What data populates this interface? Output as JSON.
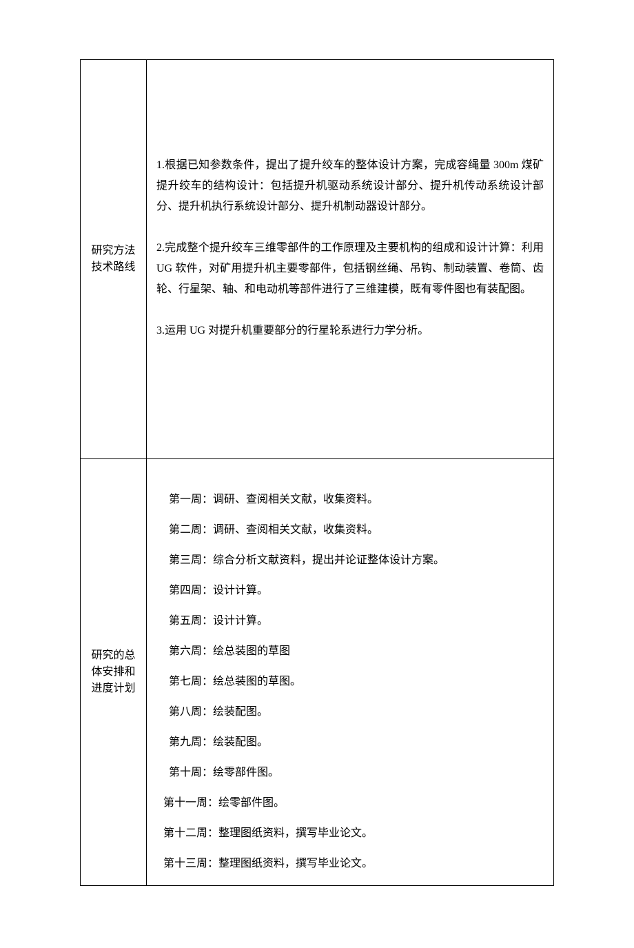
{
  "row1": {
    "label_line1": "研究方法",
    "label_line2": "技术路线",
    "p1": "1.根据已知参数条件，提出了提升绞车的整体设计方案，完成容绳量 300m 煤矿提升绞车的结构设计：包括提升机驱动系统设计部分、提升机传动系统设计部分、提升机执行系统设计部分、提升机制动器设计部分。",
    "p2": "2.完成整个提升绞车三维零部件的工作原理及主要机构的组成和设计计算：利用 UG 软件，对矿用提升机主要零部件，包括钢丝绳、吊钩、制动装置、卷筒、齿轮、行星架、轴、和电动机等部件进行了三维建模，既有零件图也有装配图。",
    "p3": "3.运用 UG 对提升机重要部分的行星轮系进行力学分析。"
  },
  "row2": {
    "label_line1": "研究的总",
    "label_line2": "体安排和",
    "label_line3": "进度计划",
    "items": [
      {
        "indent": true,
        "text": "第一周：调研、查阅相关文献，收集资料。"
      },
      {
        "indent": true,
        "text": "第二周：调研、查阅相关文献，收集资料。"
      },
      {
        "indent": true,
        "text": "第三周：综合分析文献资料，提出并论证整体设计方案。"
      },
      {
        "indent": true,
        "text": "第四周：设计计算。"
      },
      {
        "indent": true,
        "text": "第五周：设计计算。"
      },
      {
        "indent": true,
        "text": "第六周：绘总装图的草图"
      },
      {
        "indent": true,
        "text": "第七周：绘总装图的草图。"
      },
      {
        "indent": true,
        "text": "第八周：绘装配图。"
      },
      {
        "indent": true,
        "text": "第九周：绘装配图。"
      },
      {
        "indent": true,
        "text": "第十周：绘零部件图。"
      },
      {
        "indent": false,
        "text": "第十一周：绘零部件图。"
      },
      {
        "indent": false,
        "text": "第十二周：整理图纸资料，撰写毕业论文。"
      },
      {
        "indent": false,
        "text": "第十三周：整理图纸资料，撰写毕业论文。"
      }
    ]
  }
}
